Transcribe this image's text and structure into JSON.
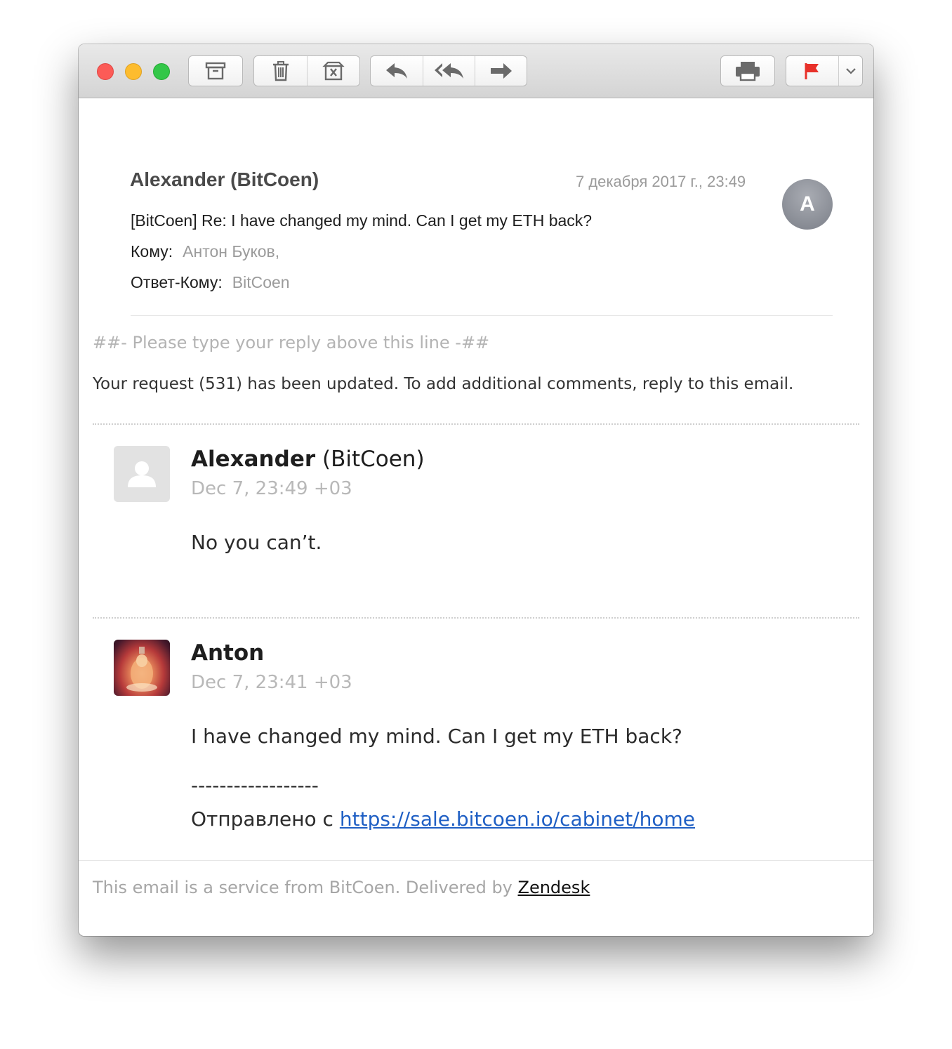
{
  "toolbar": {
    "icons": [
      "archive-icon",
      "trash-icon",
      "junk-icon",
      "reply-icon",
      "reply-all-icon",
      "forward-icon",
      "print-icon",
      "flag-icon",
      "chevron-down-icon"
    ],
    "flag_color": "#e8312a"
  },
  "header": {
    "sender": "Alexander (BitCoen)",
    "date": "7 декабря 2017 г., 23:49",
    "avatar_initial": "A",
    "subject": "[BitCoen] Re: I have changed my mind. Can I get my ETH back?",
    "to_label": "Кому:",
    "to_value": "Антон Буков,",
    "reply_to_label": "Ответ-Кому:",
    "reply_to_value": "BitCoen"
  },
  "body": {
    "reply_line": "##- Please type your reply above this line -##",
    "notice": "Your request (531) has been updated. To add additional comments, reply to this email."
  },
  "comments": [
    {
      "name": "Alexander",
      "org": " (BitCoen)",
      "date": "Dec 7, 23:49 +03",
      "text": "No you can’t."
    },
    {
      "name": "Anton",
      "org": "",
      "date": "Dec 7, 23:41 +03",
      "text": "I have changed my mind. Can I get my ETH back?",
      "separator": "------------------",
      "sent_prefix": "Отправлено с ",
      "link": "https://sale.bitcoen.io/cabinet/home"
    }
  ],
  "footer": {
    "text": "This email is a service from BitCoen. Delivered by ",
    "link": "Zendesk"
  }
}
